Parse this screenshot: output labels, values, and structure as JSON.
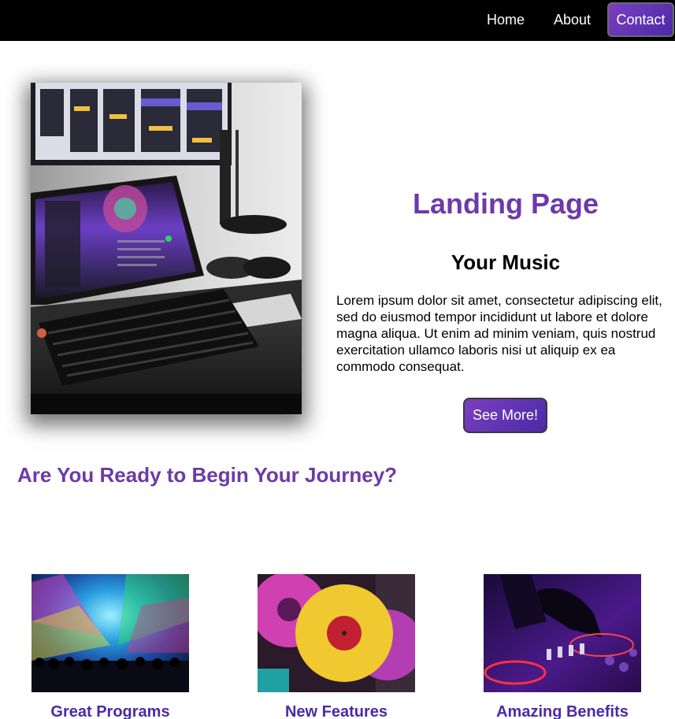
{
  "nav": {
    "home": "Home",
    "about": "About",
    "contact": "Contact"
  },
  "hero": {
    "title": "Landing Page",
    "subtitle": "Your Music",
    "text": "Lorem ipsum dolor sit amet, consectetur adipiscing elit, sed do eiusmod tempor incididunt ut labore et dolore magna aliqua. Ut enim ad minim veniam, quis nostrud exercitation ullamco laboris nisi ut aliquip ex ea commodo consequat.",
    "button": "See More!"
  },
  "journey": "Are You Ready to Begin Your Journey?",
  "cards": [
    {
      "title": "Great Programs"
    },
    {
      "title": "New Features"
    },
    {
      "title": "Amazing Benefits"
    }
  ],
  "colors": {
    "accent": "#6d3aa8",
    "button_gradient_start": "#7b3fbf",
    "button_gradient_end": "#4b2aa8",
    "nav_bg": "#000000"
  }
}
